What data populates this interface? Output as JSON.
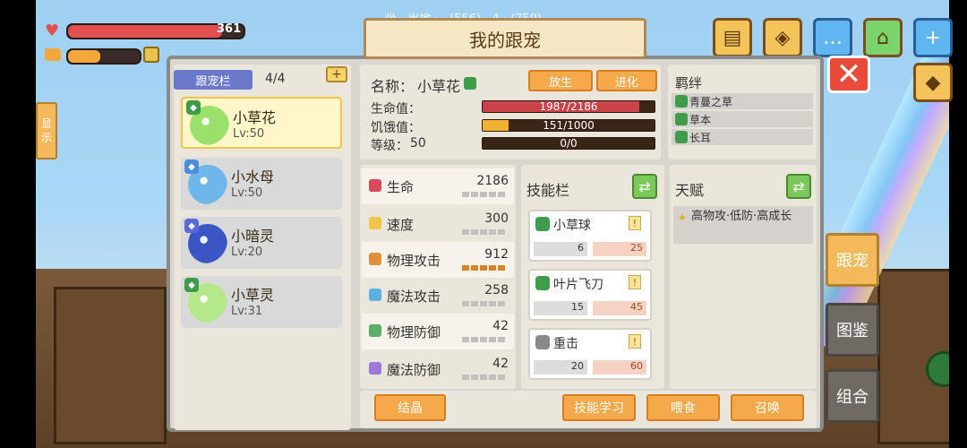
{
  "hud": {
    "hp_value": "361",
    "hp_fraction": 0.88,
    "energy_fraction": 0.45,
    "top_subtext": "坐 ·  出地 ·  · (556) · 4 · (759)",
    "hp_color": "#e05050",
    "energy_color": "#f4a73a"
  },
  "top_buttons": [
    {
      "name": "quest-icon",
      "glyph": "▤"
    },
    {
      "name": "map-icon",
      "glyph": "◈"
    },
    {
      "name": "chat-icon",
      "glyph": "…"
    },
    {
      "name": "shop-icon",
      "glyph": "⌂"
    },
    {
      "name": "plus-icon",
      "glyph": "+"
    },
    {
      "name": "cube-icon",
      "glyph": "◆"
    }
  ],
  "title": "我的跟宠",
  "left_side_tab": [
    "显",
    "示"
  ],
  "pet_list": {
    "header": "跟宠栏",
    "count": "4/4",
    "add_label": "+",
    "pets": [
      {
        "name": "小草花",
        "level": "Lv:50",
        "badge_color": "#3f9c4a",
        "icon_color": "#9be06a",
        "selected": true
      },
      {
        "name": "小水母",
        "level": "Lv:50",
        "badge_color": "#4a8ed6",
        "icon_color": "#6db7ea",
        "selected": false
      },
      {
        "name": "小暗灵",
        "level": "Lv:20",
        "badge_color": "#5a6ad6",
        "icon_color": "#3a56c4",
        "selected": false
      },
      {
        "name": "小草灵",
        "level": "Lv:31",
        "badge_color": "#3f9c4a",
        "icon_color": "#b4e88a",
        "selected": false
      }
    ]
  },
  "info": {
    "name_label": "名称：",
    "name_value": "小草花",
    "release_label": "放生",
    "evolve_label": "进化",
    "hp_label": "生命值：",
    "hp_text": "1987/2186",
    "hp_fraction": 0.909,
    "hunger_label": "饥饿值：",
    "hunger_text": "151/1000",
    "hunger_fraction": 0.151,
    "level_label": "等级：",
    "level_value": "50",
    "exp_text": "0/0",
    "exp_fraction": 0
  },
  "bond": {
    "title": "羁绊",
    "items": [
      "青蔓之草",
      "草本",
      "长耳"
    ]
  },
  "stats": [
    {
      "name": "生命",
      "value": "2186",
      "icon_color": "#d94a5a"
    },
    {
      "name": "速度",
      "value": "300",
      "icon_color": "#f0c548"
    },
    {
      "name": "物理攻击",
      "value": "912",
      "icon_color": "#e0903a"
    },
    {
      "name": "魔法攻击",
      "value": "258",
      "icon_color": "#5ab0e0"
    },
    {
      "name": "物理防御",
      "value": "42",
      "icon_color": "#5ab06a"
    },
    {
      "name": "魔法防御",
      "value": "42",
      "icon_color": "#9a7ad6"
    }
  ],
  "skills": {
    "title": "技能栏",
    "items": [
      {
        "name": "小草球",
        "cd": "6",
        "cost": "25",
        "hex_color": "#3f9c4a"
      },
      {
        "name": "叶片飞刀",
        "cd": "15",
        "cost": "45",
        "hex_color": "#3f9c4a"
      },
      {
        "name": "重击",
        "cd": "20",
        "cost": "60",
        "hex_color": "#8a8a8a"
      }
    ],
    "warn_glyph": "!"
  },
  "talent": {
    "title": "天赋",
    "text": "高物攻·低防·高成长"
  },
  "bottom_buttons": {
    "crystal": "结晶",
    "learn_skill": "技能学习",
    "feed": "喂食",
    "summon": "召唤"
  },
  "side_buttons": [
    "跟宠",
    "图鉴",
    "组合"
  ],
  "close_glyph": "✕",
  "swap_glyph": "⇄"
}
